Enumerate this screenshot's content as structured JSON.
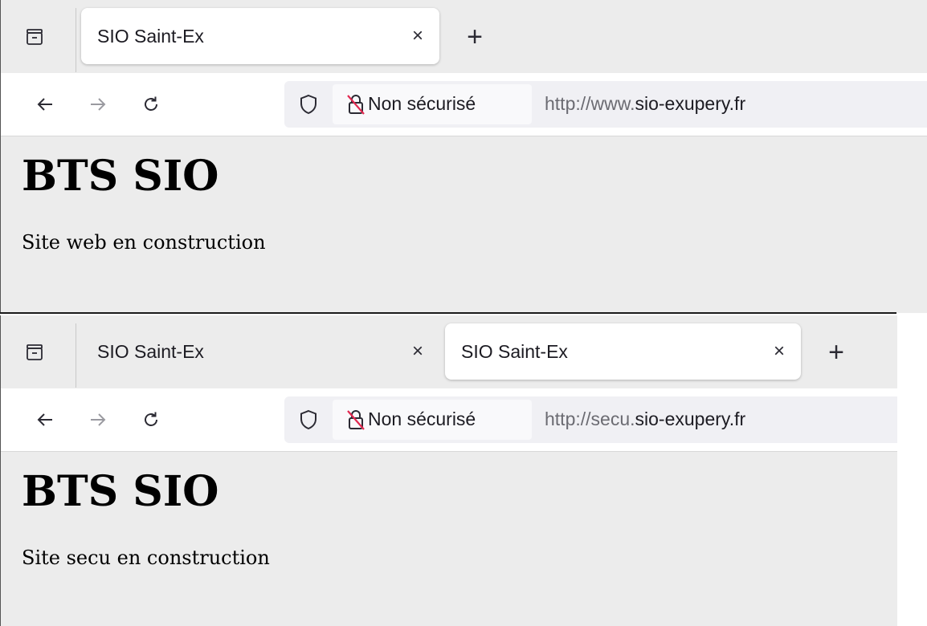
{
  "windows": [
    {
      "tabs": [
        {
          "title": "SIO Saint-Ex",
          "active": true
        }
      ],
      "close_glyph": "×",
      "new_tab_glyph": "+",
      "nav": {
        "back": "←",
        "forward": "→"
      },
      "security_label": "Non sécurisé",
      "url": {
        "prefix": "http://www.",
        "domain": "sio-exupery.fr"
      },
      "page": {
        "heading": "BTS SIO",
        "text": "Site web en construction"
      }
    },
    {
      "tabs": [
        {
          "title": "SIO Saint-Ex",
          "active": false
        },
        {
          "title": "SIO Saint-Ex",
          "active": true
        }
      ],
      "close_glyph": "×",
      "new_tab_glyph": "+",
      "nav": {
        "back": "←",
        "forward": "→"
      },
      "security_label": "Non sécurisé",
      "url": {
        "prefix": "http://secu.",
        "domain": "sio-exupery.fr"
      },
      "page": {
        "heading": "BTS SIO",
        "text": "Site secu en construction"
      }
    }
  ],
  "icons": [
    "list-all-tabs-icon",
    "back-arrow-icon",
    "forward-arrow-icon",
    "reload-icon",
    "shield-icon",
    "insecure-lock-icon"
  ],
  "colors": {
    "insecure_strike": "#e22850",
    "chrome_bg": "#ececec",
    "url_bg": "#f0f0f4"
  }
}
